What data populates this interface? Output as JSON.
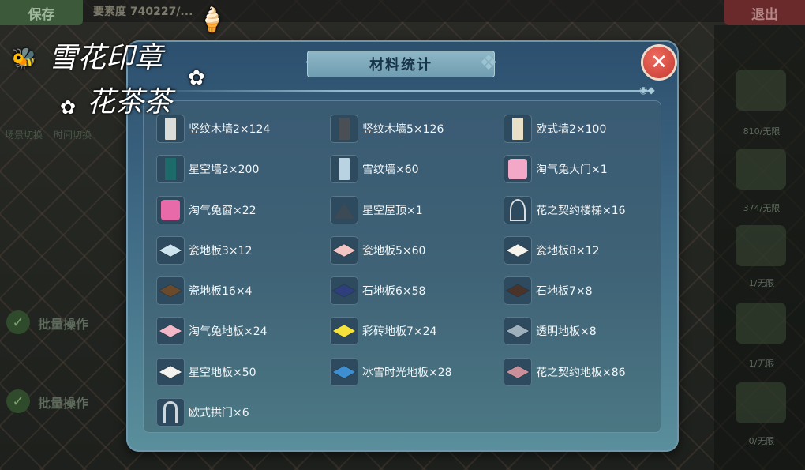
{
  "background": {
    "save_label": "保存",
    "exit_label": "退出",
    "ticket_text": "要素度 740227/...",
    "left_labels": [
      "场景切换",
      "时间切换"
    ],
    "batch_label_1": "批量操作",
    "batch_label_2": "批量操作",
    "slot_labels": [
      "810/无限",
      "374/无限",
      "1/无限",
      "1/无限",
      "0/无限"
    ]
  },
  "watermark": {
    "line1": "雪花印章",
    "line2": "花茶茶"
  },
  "dialog": {
    "title": "材料统计",
    "close_icon": "close-x-icon",
    "materials": [
      {
        "label": "竖纹木墙2×124",
        "icon": "wall-light-icon",
        "color": "#d9dcd8"
      },
      {
        "label": "竖纹木墙5×126",
        "icon": "wall-dark-icon",
        "color": "#4a4f55"
      },
      {
        "label": "欧式墙2×100",
        "icon": "wall-euro-icon",
        "color": "#e9e0c8"
      },
      {
        "label": "星空墙2×200",
        "icon": "wall-starry-icon",
        "color": "#1d6a6a"
      },
      {
        "label": "雪纹墙×60",
        "icon": "wall-snow-icon",
        "color": "#b9d3e2"
      },
      {
        "label": "淘气兔大门×1",
        "icon": "bunny-door-icon",
        "color": "#f4a8c8"
      },
      {
        "label": "淘气兔窗×22",
        "icon": "bunny-window-icon",
        "color": "#e86aa8"
      },
      {
        "label": "星空屋顶×1",
        "icon": "starry-roof-icon",
        "color": "#3c4a55"
      },
      {
        "label": "花之契约楼梯×16",
        "icon": "spiral-stairs-icon",
        "color": "#d7dde0"
      },
      {
        "label": "瓷地板3×12",
        "icon": "tile-icon",
        "color": "#cde3ee"
      },
      {
        "label": "瓷地板5×60",
        "icon": "tile-icon",
        "color": "#f2c4c4"
      },
      {
        "label": "瓷地板8×12",
        "icon": "tile-icon",
        "color": "#f6f2ec"
      },
      {
        "label": "瓷地板16×4",
        "icon": "tile-icon",
        "color": "#6a4a2a"
      },
      {
        "label": "石地板6×58",
        "icon": "tile-icon",
        "color": "#2f3f7e"
      },
      {
        "label": "石地板7×8",
        "icon": "tile-icon",
        "color": "#4a3328"
      },
      {
        "label": "淘气兔地板×24",
        "icon": "tile-icon",
        "color": "#f3b8c8"
      },
      {
        "label": "彩砖地板7×24",
        "icon": "tile-icon",
        "color": "#f5e23a"
      },
      {
        "label": "透明地板×8",
        "icon": "tile-icon",
        "color": "#9fb0bd"
      },
      {
        "label": "星空地板×50",
        "icon": "tile-icon",
        "color": "#f4f2ee"
      },
      {
        "label": "冰雪时光地板×28",
        "icon": "tile-icon",
        "color": "#3d8fd1"
      },
      {
        "label": "花之契约地板×86",
        "icon": "tile-icon",
        "color": "#c98f9a"
      },
      {
        "label": "欧式拱门×6",
        "icon": "arch-door-icon",
        "color": "#cfd6dc"
      }
    ]
  }
}
